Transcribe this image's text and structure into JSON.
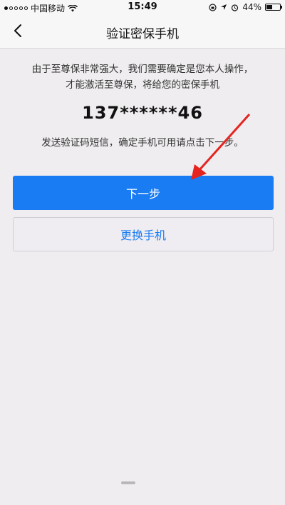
{
  "status_bar": {
    "carrier": "中国移动",
    "time": "15:49",
    "battery_text": "44%",
    "battery_level": 0.44,
    "signal_strength": 1
  },
  "nav": {
    "title": "验证密保手机"
  },
  "main": {
    "intro": "由于至尊保非常强大，我们需要确定是您本人操作，才能激活至尊保，将给您的密保手机",
    "phone_number": "137******46",
    "hint": "发送验证码短信，确定手机可用请点击下一步。"
  },
  "buttons": {
    "next_label": "下一步",
    "change_label": "更换手机"
  },
  "colors": {
    "accent": "#1a7cf3",
    "annotation_arrow": "#e52420"
  },
  "icons": {
    "back": "chevron-left-icon",
    "wifi": "wifi-icon",
    "lock_rotation": "lock-rotation-icon",
    "location": "location-arrow-icon",
    "alarm": "alarm-icon",
    "battery": "battery-icon"
  }
}
